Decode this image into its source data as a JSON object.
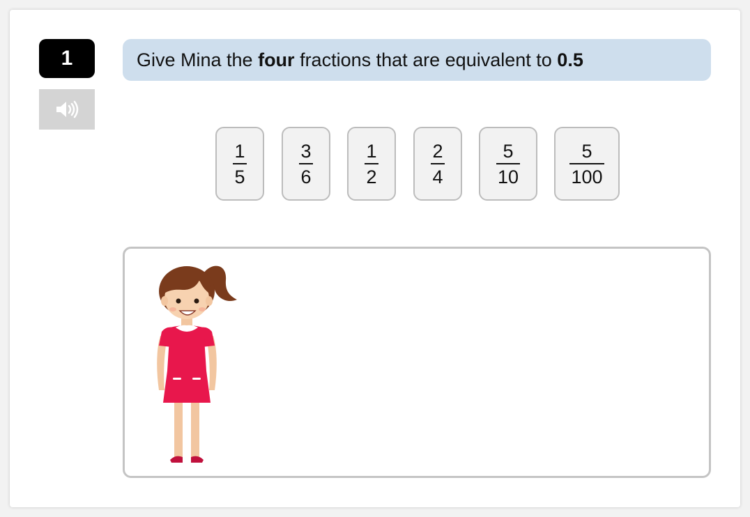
{
  "question": {
    "number": "1",
    "prompt_parts": {
      "p1": "Give Mina the ",
      "p2": "four",
      "p3": " fractions that are equivalent to ",
      "p4": "0.5"
    }
  },
  "audio": {
    "icon": "speaker-icon"
  },
  "fractions": [
    {
      "numerator": "1",
      "denominator": "5"
    },
    {
      "numerator": "3",
      "denominator": "6"
    },
    {
      "numerator": "1",
      "denominator": "2"
    },
    {
      "numerator": "2",
      "denominator": "4"
    },
    {
      "numerator": "5",
      "denominator": "10"
    },
    {
      "numerator": "5",
      "denominator": "100"
    }
  ],
  "colors": {
    "prompt_background": "#cedeed",
    "tile_background": "#f2f2f2",
    "dress": "#e8174c",
    "hair": "#7a3b1c"
  }
}
